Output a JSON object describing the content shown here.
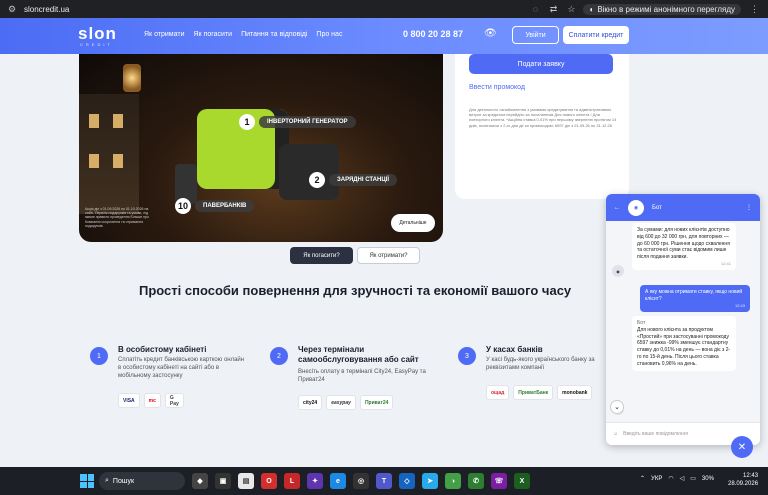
{
  "browser": {
    "url": "sloncredit.ua",
    "incognito_label": "Вікно в режимі анонімного перегляду"
  },
  "nav": {
    "logo": "slon",
    "logo_sub": "CREDIT",
    "links": [
      "Як отримати",
      "Як погасити",
      "Питання та відповіді",
      "Про нас"
    ],
    "phone": "0 800 20 28 87",
    "login": "Увійти",
    "pay": "Сплатити кредит"
  },
  "hero": {
    "tag1_num": "1",
    "tag1": "ІНВЕРТОРНИЙ ГЕНЕРАТОР",
    "tag2_num": "2",
    "tag2": "ЗАРЯДНІ СТАНЦІЇ",
    "tag3_num": "10",
    "tag3": "ПАВЕРБАНКІВ",
    "promo_note": "Акція діє з 01.09.2026 по 01.10.2026 на сайті. Перелік подарунків та умови, під якими правило проведення Більше про Компанію скорочення та отримання подарунків.",
    "details": "Детальніше"
  },
  "form": {
    "apply": "Подати заявку",
    "promo_link": "Ввести промокод",
    "fine_print": "Для детального ознайомлення з умовами кредитування та адміністративних витрат за кредитом перейдіть за посиланням Для нового клієнта / Для повторного клієнта. *Акційна ставка 0,01% при першому зверненні протягом 14 днів, починаючи з 2-го дня дії за промокодом: 6597 діє з 21.09.26 по 31.12.26"
  },
  "tabs": {
    "repay": "Як погасити?",
    "get": "Як отримати?"
  },
  "heading": "Прості способи повернення для зручності та економії вашого часу",
  "steps": [
    {
      "num": "1",
      "title": "В особистому кабінеті",
      "desc": "Сплатіть кредит банківською карткою онлайн в особистому кабінеті на сайті або в мобільному застосунку",
      "pays": [
        "VISA",
        "mc",
        "G Pay"
      ]
    },
    {
      "num": "2",
      "title": "Через термінали самообслуговування або сайт",
      "desc": "Внесіть оплату в терміналі City24, EasyPay та Приват24",
      "pays": [
        "city24",
        "easypay",
        "Приват24"
      ]
    },
    {
      "num": "3",
      "title": "У касах банків",
      "desc": "У касі будь-якого українського банку за реквізитами компанії",
      "pays": [
        "ощад",
        "ПриватБанк",
        "monobank"
      ]
    }
  ],
  "chat": {
    "bot_name": "Бот",
    "msg1": "За сумами: для нових клієнтів доступно від 600 до 32 000 грн, для повторних — до 60 000 грн. Рішення щодо схвалення та остаточної суми стає відомим лише після подання заявки.",
    "msg1_time": "12:41",
    "user_msg": "А яку можна отримати ставку, якщо новий клієнт?",
    "user_time": "12:43",
    "bot_label": "Бот",
    "msg2": "Для нового клієнта за продуктом «Простий» при застосуванні промокоду 6597 знижка -99% зменшує стандартну ставку до 0,01% на день — вона діє з 2-го по 15-й день. Після цього ставка становить 0,96% на день.",
    "input_placeholder": "Введіть ваше повідомлення"
  },
  "taskbar": {
    "search": "Пошук",
    "lang": "УКР",
    "battery": "30%",
    "time": "12:43",
    "date": "28.09.2026"
  }
}
